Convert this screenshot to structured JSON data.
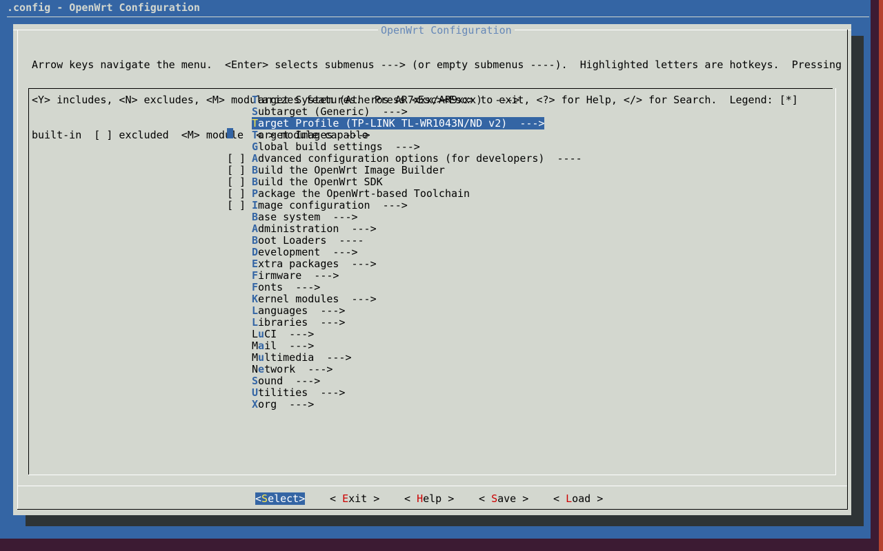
{
  "window": {
    "title": ".config - OpenWrt Configuration"
  },
  "dialog": {
    "title": "OpenWrt Configuration",
    "help_lines": [
      "Arrow keys navigate the menu.  <Enter> selects submenus ---> (or empty submenus ----).  Highlighted letters are hotkeys.  Pressing",
      "<Y> includes, <N> excludes, <M> modularizes features.  Press <Esc><Esc> to exit, <?> for Help, </> for Search.  Legend: [*]",
      "built-in  [ ] excluded  <M> module  < > module capable"
    ]
  },
  "menu": {
    "selected_index": 2,
    "items": [
      {
        "check": "",
        "hotkey": "T",
        "rest": "arget System (Atheros AR7xxx/AR9xxx)  --->"
      },
      {
        "check": "",
        "hotkey": "S",
        "rest": "ubtarget (Generic)  --->"
      },
      {
        "check": "",
        "hotkey": "T",
        "rest": "arget Profile (TP-LINK TL-WR1043N/ND v2)  --->"
      },
      {
        "check": "",
        "hotkey": "T",
        "rest": "arget Images  --->"
      },
      {
        "check": "",
        "hotkey": "G",
        "rest": "lobal build settings  --->"
      },
      {
        "check": "[ ]",
        "hotkey": "A",
        "rest": "dvanced configuration options (for developers)  ----"
      },
      {
        "check": "[ ]",
        "hotkey": "B",
        "rest": "uild the OpenWrt Image Builder"
      },
      {
        "check": "[ ]",
        "hotkey": "B",
        "rest": "uild the OpenWrt SDK"
      },
      {
        "check": "[ ]",
        "hotkey": "P",
        "rest": "ackage the OpenWrt-based Toolchain"
      },
      {
        "check": "[ ]",
        "hotkey": "I",
        "rest": "mage configuration  --->"
      },
      {
        "check": "",
        "hotkey": "B",
        "rest": "ase system  --->"
      },
      {
        "check": "",
        "hotkey": "A",
        "rest": "dministration  --->"
      },
      {
        "check": "",
        "hotkey": "B",
        "rest": "oot Loaders  ----"
      },
      {
        "check": "",
        "hotkey": "D",
        "rest": "evelopment  --->"
      },
      {
        "check": "",
        "hotkey": "E",
        "rest": "xtra packages  --->"
      },
      {
        "check": "",
        "hotkey": "F",
        "rest": "irmware  --->"
      },
      {
        "check": "",
        "hotkey": "F",
        "rest": "onts  --->"
      },
      {
        "check": "",
        "hotkey": "K",
        "rest": "ernel modules  --->"
      },
      {
        "check": "",
        "hotkey": "L",
        "rest": "anguages  --->"
      },
      {
        "check": "",
        "hotkey": "L",
        "rest": "ibraries  --->"
      },
      {
        "check": "",
        "pre": "L",
        "hotkey": "u",
        "rest": "CI  --->"
      },
      {
        "check": "",
        "pre": "M",
        "hotkey": "a",
        "rest": "il  --->"
      },
      {
        "check": "",
        "pre": "M",
        "hotkey": "u",
        "rest": "ltimedia  --->"
      },
      {
        "check": "",
        "pre": "N",
        "hotkey": "e",
        "rest": "twork  --->"
      },
      {
        "check": "",
        "hotkey": "S",
        "rest": "ound  --->"
      },
      {
        "check": "",
        "hotkey": "U",
        "rest": "tilities  --->"
      },
      {
        "check": "",
        "hotkey": "X",
        "rest": "org  --->"
      }
    ]
  },
  "buttons": [
    {
      "pre": "<",
      "hotkey": "S",
      "rest": "elect>",
      "active": true
    },
    {
      "pre": "< ",
      "hotkey": "E",
      "rest": "xit >",
      "active": false
    },
    {
      "pre": "< ",
      "hotkey": "H",
      "rest": "elp >",
      "active": false
    },
    {
      "pre": "< ",
      "hotkey": "S",
      "rest": "ave >",
      "active": false
    },
    {
      "pre": "< ",
      "hotkey": "L",
      "rest": "oad >",
      "active": false
    }
  ],
  "colors": {
    "terminal_bg": "#3465a4",
    "dialog_bg": "#d3d7cf",
    "selection_bg": "#3465a4",
    "hotkey_menu": "#3465a4",
    "hotkey_button": "#cc0000",
    "hotkey_selected": "#fce94f"
  }
}
